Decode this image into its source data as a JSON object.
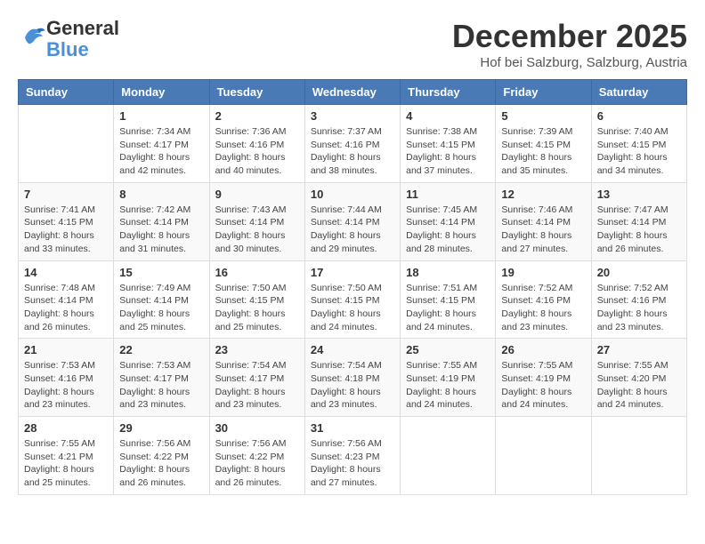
{
  "header": {
    "logo_general": "General",
    "logo_blue": "Blue",
    "month_title": "December 2025",
    "location": "Hof bei Salzburg, Salzburg, Austria"
  },
  "weekdays": [
    "Sunday",
    "Monday",
    "Tuesday",
    "Wednesday",
    "Thursday",
    "Friday",
    "Saturday"
  ],
  "weeks": [
    [
      {
        "day": "",
        "info": ""
      },
      {
        "day": "1",
        "info": "Sunrise: 7:34 AM\nSunset: 4:17 PM\nDaylight: 8 hours\nand 42 minutes."
      },
      {
        "day": "2",
        "info": "Sunrise: 7:36 AM\nSunset: 4:16 PM\nDaylight: 8 hours\nand 40 minutes."
      },
      {
        "day": "3",
        "info": "Sunrise: 7:37 AM\nSunset: 4:16 PM\nDaylight: 8 hours\nand 38 minutes."
      },
      {
        "day": "4",
        "info": "Sunrise: 7:38 AM\nSunset: 4:15 PM\nDaylight: 8 hours\nand 37 minutes."
      },
      {
        "day": "5",
        "info": "Sunrise: 7:39 AM\nSunset: 4:15 PM\nDaylight: 8 hours\nand 35 minutes."
      },
      {
        "day": "6",
        "info": "Sunrise: 7:40 AM\nSunset: 4:15 PM\nDaylight: 8 hours\nand 34 minutes."
      }
    ],
    [
      {
        "day": "7",
        "info": "Sunrise: 7:41 AM\nSunset: 4:15 PM\nDaylight: 8 hours\nand 33 minutes."
      },
      {
        "day": "8",
        "info": "Sunrise: 7:42 AM\nSunset: 4:14 PM\nDaylight: 8 hours\nand 31 minutes."
      },
      {
        "day": "9",
        "info": "Sunrise: 7:43 AM\nSunset: 4:14 PM\nDaylight: 8 hours\nand 30 minutes."
      },
      {
        "day": "10",
        "info": "Sunrise: 7:44 AM\nSunset: 4:14 PM\nDaylight: 8 hours\nand 29 minutes."
      },
      {
        "day": "11",
        "info": "Sunrise: 7:45 AM\nSunset: 4:14 PM\nDaylight: 8 hours\nand 28 minutes."
      },
      {
        "day": "12",
        "info": "Sunrise: 7:46 AM\nSunset: 4:14 PM\nDaylight: 8 hours\nand 27 minutes."
      },
      {
        "day": "13",
        "info": "Sunrise: 7:47 AM\nSunset: 4:14 PM\nDaylight: 8 hours\nand 26 minutes."
      }
    ],
    [
      {
        "day": "14",
        "info": "Sunrise: 7:48 AM\nSunset: 4:14 PM\nDaylight: 8 hours\nand 26 minutes."
      },
      {
        "day": "15",
        "info": "Sunrise: 7:49 AM\nSunset: 4:14 PM\nDaylight: 8 hours\nand 25 minutes."
      },
      {
        "day": "16",
        "info": "Sunrise: 7:50 AM\nSunset: 4:15 PM\nDaylight: 8 hours\nand 25 minutes."
      },
      {
        "day": "17",
        "info": "Sunrise: 7:50 AM\nSunset: 4:15 PM\nDaylight: 8 hours\nand 24 minutes."
      },
      {
        "day": "18",
        "info": "Sunrise: 7:51 AM\nSunset: 4:15 PM\nDaylight: 8 hours\nand 24 minutes."
      },
      {
        "day": "19",
        "info": "Sunrise: 7:52 AM\nSunset: 4:16 PM\nDaylight: 8 hours\nand 23 minutes."
      },
      {
        "day": "20",
        "info": "Sunrise: 7:52 AM\nSunset: 4:16 PM\nDaylight: 8 hours\nand 23 minutes."
      }
    ],
    [
      {
        "day": "21",
        "info": "Sunrise: 7:53 AM\nSunset: 4:16 PM\nDaylight: 8 hours\nand 23 minutes."
      },
      {
        "day": "22",
        "info": "Sunrise: 7:53 AM\nSunset: 4:17 PM\nDaylight: 8 hours\nand 23 minutes."
      },
      {
        "day": "23",
        "info": "Sunrise: 7:54 AM\nSunset: 4:17 PM\nDaylight: 8 hours\nand 23 minutes."
      },
      {
        "day": "24",
        "info": "Sunrise: 7:54 AM\nSunset: 4:18 PM\nDaylight: 8 hours\nand 23 minutes."
      },
      {
        "day": "25",
        "info": "Sunrise: 7:55 AM\nSunset: 4:19 PM\nDaylight: 8 hours\nand 24 minutes."
      },
      {
        "day": "26",
        "info": "Sunrise: 7:55 AM\nSunset: 4:19 PM\nDaylight: 8 hours\nand 24 minutes."
      },
      {
        "day": "27",
        "info": "Sunrise: 7:55 AM\nSunset: 4:20 PM\nDaylight: 8 hours\nand 24 minutes."
      }
    ],
    [
      {
        "day": "28",
        "info": "Sunrise: 7:55 AM\nSunset: 4:21 PM\nDaylight: 8 hours\nand 25 minutes."
      },
      {
        "day": "29",
        "info": "Sunrise: 7:56 AM\nSunset: 4:22 PM\nDaylight: 8 hours\nand 26 minutes."
      },
      {
        "day": "30",
        "info": "Sunrise: 7:56 AM\nSunset: 4:22 PM\nDaylight: 8 hours\nand 26 minutes."
      },
      {
        "day": "31",
        "info": "Sunrise: 7:56 AM\nSunset: 4:23 PM\nDaylight: 8 hours\nand 27 minutes."
      },
      {
        "day": "",
        "info": ""
      },
      {
        "day": "",
        "info": ""
      },
      {
        "day": "",
        "info": ""
      }
    ]
  ]
}
